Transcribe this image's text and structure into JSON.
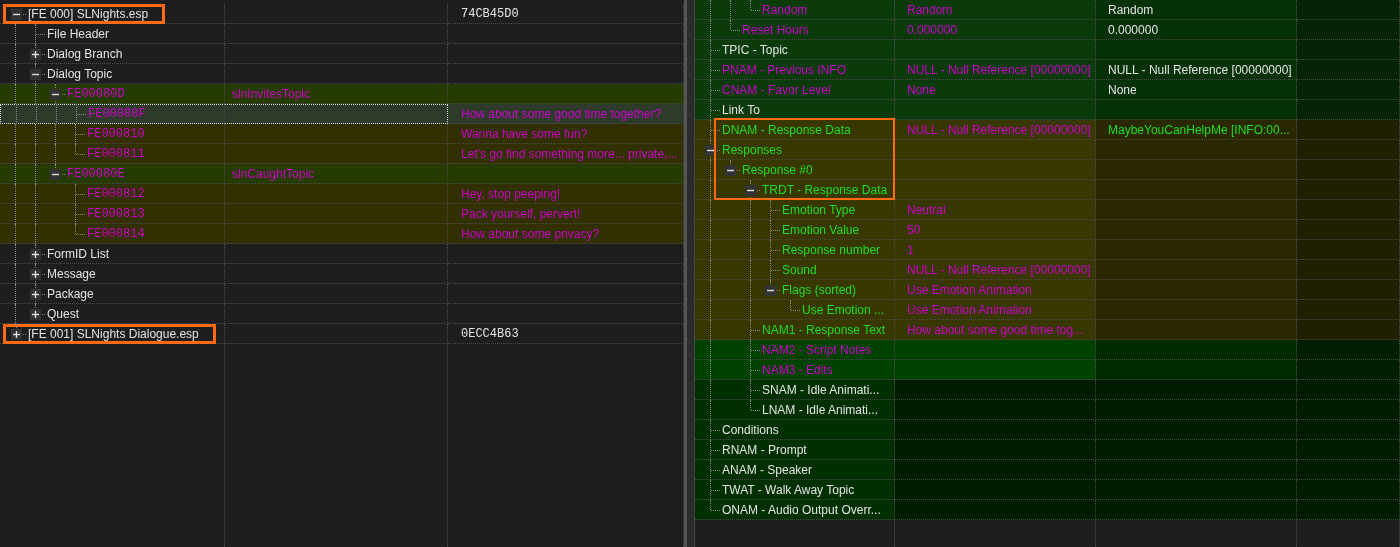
{
  "left_tree": [
    {
      "label": "[FE 000] SLNights.esp",
      "expanded": true,
      "highlighted": true,
      "column_3": "74CB45D0",
      "children": [
        {
          "label": "File Header"
        },
        {
          "label": "Dialog Branch",
          "expanded": false
        },
        {
          "label": "Dialog Topic",
          "expanded": true,
          "children": [
            {
              "label": "FE00080D",
              "kind": "topic",
              "editor_id": "slnInvitesTopic",
              "expanded": true,
              "children": [
                {
                  "label": "FE00080F",
                  "kind": "info",
                  "selected": true,
                  "text": "How about some good time together?"
                },
                {
                  "label": "FE000810",
                  "kind": "info",
                  "selected": false,
                  "text": "Wanna have some fun?"
                },
                {
                  "label": "FE000811",
                  "kind": "info",
                  "selected": false,
                  "text": "Let's go find something more... private,..."
                }
              ]
            },
            {
              "label": "FE00080E",
              "kind": "topic",
              "editor_id": "slnCaughtTopic",
              "expanded": true,
              "children": [
                {
                  "label": "FE000812",
                  "kind": "info",
                  "selected": false,
                  "text": "Hey, stop peeping!"
                },
                {
                  "label": "FE000813",
                  "kind": "info",
                  "selected": false,
                  "text": "Pack yourself, pervert!"
                },
                {
                  "label": "FE000814",
                  "kind": "info",
                  "selected": false,
                  "text": "How about some privacy?"
                }
              ]
            }
          ]
        },
        {
          "label": "FormID List",
          "expanded": false
        },
        {
          "label": "Message",
          "expanded": false
        },
        {
          "label": "Package",
          "expanded": false
        },
        {
          "label": "Quest",
          "expanded": false
        }
      ]
    },
    {
      "label": "[FE 001] SLNights Dialogue.esp",
      "expanded": false,
      "highlighted": true,
      "column_3": "0ECC4B63"
    }
  ],
  "record_view": [
    {
      "children": [
        {
          "children": [
            {
              "name": "Random",
              "color": "#cc00cc",
              "kind": "override",
              "values": [
                {
                  "text": "Random",
                  "color": "#cc00cc"
                },
                {
                  "text": "Random",
                  "color": "#e4e4e4"
                }
              ]
            }
          ]
        },
        {
          "name": "Reset Hours",
          "color": "#cc00cc",
          "kind": "override",
          "values": [
            {
              "text": "0.000000",
              "color": "#cc00cc"
            },
            {
              "text": "0.000000",
              "color": "#e4e4e4"
            }
          ]
        }
      ]
    },
    {
      "name": "TPIC - Topic",
      "color": "#e4e4e4",
      "kind": "override"
    },
    {
      "name": "PNAM - Previous INFO",
      "color": "#cc00cc",
      "kind": "override",
      "values": [
        {
          "text": "NULL - Null Reference [00000000]",
          "color": "#cc00cc"
        },
        {
          "text": "NULL - Null Reference [00000000]",
          "color": "#e4e4e4"
        }
      ]
    },
    {
      "name": "CNAM - Favor Level",
      "color": "#cc00cc",
      "kind": "override",
      "values": [
        {
          "text": "None",
          "color": "#cc00cc"
        },
        {
          "text": "None",
          "color": "#e4e4e4"
        }
      ]
    },
    {
      "name": "Link To",
      "color": "#e4e4e4",
      "kind": "override"
    },
    {
      "name": "DNAM - Response Data",
      "color": "#22dd22",
      "kind": "conflict",
      "highlighted": true,
      "values": [
        {
          "text": "NULL - Null Reference [00000000]",
          "color": "#cc00cc"
        },
        {
          "text": "MaybeYouCanHelpMe [INFO:00...",
          "color": "#22dd22"
        }
      ]
    },
    {
      "name": "Responses",
      "color": "#22dd22",
      "kind": "conflict",
      "highlighted": true,
      "expanded": true,
      "children": [
        {
          "name": "Response #0",
          "color": "#22dd22",
          "kind": "conflict",
          "highlighted": true,
          "expanded": true,
          "children": [
            {
              "name": "TRDT - Response Data",
              "color": "#22dd22",
              "kind": "conflict",
              "highlighted": true,
              "expanded": true,
              "children": [
                {
                  "name": "Emotion Type",
                  "color": "#22dd22",
                  "kind": "conflict",
                  "values": [
                    {
                      "text": "Neutral",
                      "color": "#cc00cc"
                    }
                  ]
                },
                {
                  "name": "Emotion Value",
                  "color": "#22dd22",
                  "kind": "conflict",
                  "values": [
                    {
                      "text": "50",
                      "color": "#cc00cc"
                    }
                  ]
                },
                {
                  "name": "Response number",
                  "color": "#22dd22",
                  "kind": "conflict",
                  "values": [
                    {
                      "text": "1",
                      "color": "#cc00cc"
                    }
                  ]
                },
                {
                  "name": "Sound",
                  "color": "#22dd22",
                  "kind": "conflict",
                  "values": [
                    {
                      "text": "NULL - Null Reference [00000000]",
                      "color": "#cc00cc"
                    }
                  ]
                },
                {
                  "name": "Flags (sorted)",
                  "color": "#22dd22",
                  "kind": "conflict",
                  "expanded": true,
                  "values": [
                    {
                      "text": "Use Emotion Animation",
                      "color": "#cc00cc"
                    }
                  ],
                  "children": [
                    {
                      "name": "Use Emotion ...",
                      "color": "#22dd22",
                      "kind": "conflict",
                      "values": [
                        {
                          "text": "Use Emotion Animation",
                          "color": "#cc00cc"
                        }
                      ]
                    }
                  ]
                }
              ]
            },
            {
              "name": "NAM1 - Response Text",
              "color": "#22dd22",
              "kind": "conflict",
              "values": [
                {
                  "text": "How about some good time tog...",
                  "color": "#cc00cc"
                }
              ]
            },
            {
              "name": "NAM2 - Script Notes",
              "color": "#cc00cc",
              "kind": "new"
            },
            {
              "name": "NAM3 - Edits",
              "color": "#cc00cc",
              "kind": "new"
            },
            {
              "name": "SNAM - Idle Animati...",
              "color": "#e4e4e4",
              "kind": "unchanged"
            },
            {
              "name": "LNAM - Idle Animati...",
              "color": "#e4e4e4",
              "kind": "unchanged"
            }
          ]
        }
      ]
    },
    {
      "name": "Conditions",
      "color": "#e4e4e4",
      "kind": "unchanged"
    },
    {
      "name": "RNAM - Prompt",
      "color": "#e4e4e4",
      "kind": "unchanged"
    },
    {
      "name": "ANAM - Speaker",
      "color": "#e4e4e4",
      "kind": "unchanged"
    },
    {
      "name": "TWAT - Walk Away Topic",
      "color": "#e4e4e4",
      "kind": "unchanged"
    },
    {
      "name": "ONAM - Audio Output Overr...",
      "color": "#e4e4e4",
      "kind": "unchanged"
    }
  ]
}
